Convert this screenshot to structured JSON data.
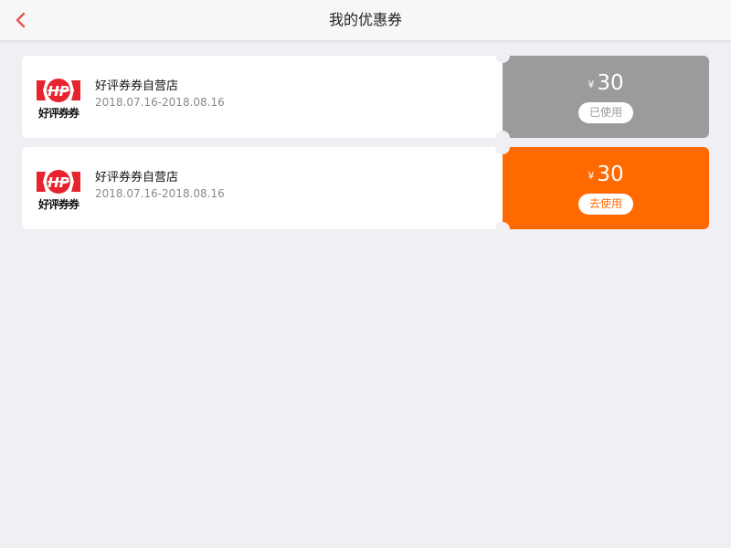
{
  "header": {
    "title": "我的优惠券",
    "back_icon": "chevron-left-icon",
    "back_color": "#e8544f"
  },
  "coupons": [
    {
      "logo_text": "好评券券",
      "shop_name": "好评券券自营店",
      "validity": "2018.07.16-2018.08.16",
      "currency": "¥",
      "amount": "30",
      "action_label": "已使用",
      "status": "used",
      "color": "#9b9b9b"
    },
    {
      "logo_text": "好评券券",
      "shop_name": "好评券券自营店",
      "validity": "2018.07.16-2018.08.16",
      "currency": "¥",
      "amount": "30",
      "action_label": "去使用",
      "status": "available",
      "color": "#ff6a00"
    }
  ],
  "colors": {
    "background": "#efeff4",
    "logo_red": "#e6232e"
  }
}
